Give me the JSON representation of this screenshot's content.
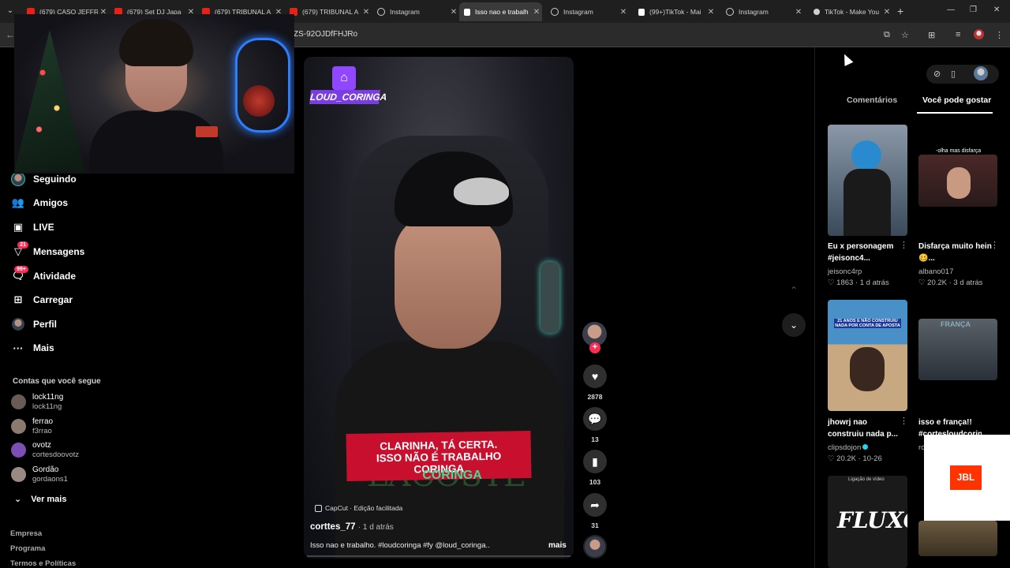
{
  "browser": {
    "tabs": [
      {
        "title": "(679) CASO JEFFR",
        "icon": "youtube-icon"
      },
      {
        "title": "(679) Set DJ Japa",
        "icon": "youtube-icon"
      },
      {
        "title": "(679) TRIBUNAL A",
        "icon": "youtube-icon"
      },
      {
        "title": "(679) TRIBUNAL A",
        "icon": "youtube-icon"
      },
      {
        "title": "Instagram",
        "icon": "instagram-icon"
      },
      {
        "title": "Isso nao e trabalh",
        "icon": "tiktok-icon",
        "active": true
      },
      {
        "title": "Instagram",
        "icon": "instagram-icon"
      },
      {
        "title": "(99+)TikTok - Mai",
        "icon": "tiktok-icon"
      },
      {
        "title": "Instagram",
        "icon": "instagram-icon"
      },
      {
        "title": "TikTok - Make You",
        "icon": "tiktok-icon"
      }
    ],
    "url_fragment": "ZS-92OJDfFHJRo"
  },
  "sidebar": {
    "items": [
      {
        "label": "Seguindo",
        "icon": "following-avatar-icon"
      },
      {
        "label": "Amigos",
        "icon": "friends-icon"
      },
      {
        "label": "LIVE",
        "icon": "live-icon"
      },
      {
        "label": "Mensagens",
        "icon": "messages-icon",
        "badge": "21"
      },
      {
        "label": "Atividade",
        "icon": "activity-icon",
        "badge": "99+"
      },
      {
        "label": "Carregar",
        "icon": "upload-icon"
      },
      {
        "label": "Perfil",
        "icon": "profile-icon"
      },
      {
        "label": "Mais",
        "icon": "more-icon"
      }
    ],
    "following_header": "Contas que você segue",
    "accounts": [
      {
        "name": "lock11ng",
        "username": "lock11ng",
        "color": "#6a5a55"
      },
      {
        "name": "ferrao",
        "username": "f3rrao",
        "color": "#8a7a70"
      },
      {
        "name": "ovotz",
        "username": "cortesdoovotz",
        "color": "#7b4fb3"
      },
      {
        "name": "Gordão",
        "username": "gordaons1",
        "color": "#9a8a84"
      }
    ],
    "see_more": "Ver mais",
    "footer": [
      "Empresa",
      "Programa",
      "Termos e Políticas"
    ]
  },
  "video": {
    "channel_badge": "LOUD_CORINGA",
    "caption_lines": [
      "CLARINHA, TÁ CERTA.",
      "ISSO NÃO É TRABALHO",
      "CORINGA"
    ],
    "caption_accent": "CORINGA",
    "shirt_text": "LACOSTE",
    "capcut_label": "CapCut · Edição facilitada",
    "author": "corttes_77",
    "time_ago": "· 1 d atrás",
    "description": "Isso nao e trabalho. #loudcoringa #fy @loud_coringa..",
    "more_label": "mais"
  },
  "actions": {
    "likes": "2878",
    "comments": "13",
    "saves": "103",
    "shares": "31"
  },
  "right_panel": {
    "tab_comments": "Comentários",
    "tab_recommended": "Você pode gostar",
    "videos": [
      {
        "title": "Eu x personagem #jeisonc4...",
        "author": "jeisonc4rp",
        "stats": "♡ 1863 · 1 d atrás",
        "color": "#4a6a8a"
      },
      {
        "title": "Disfarça muito hein 🥴...",
        "author": "albano017",
        "stats": "♡ 20.2K · 3 d atrás",
        "color": "#5a3030",
        "overlay": "-olha mas disfarça"
      },
      {
        "title": "jhowrj nao construiu nada p...",
        "author": "clipsdojon",
        "stats": "♡ 20.2K · 10-26",
        "color": "#5a8ab0",
        "verified": true,
        "overlay": "21 ANOS E NÃO CONSTRUIU NADA POR CONTA DE APOSTA"
      },
      {
        "title": "isso e frança!! #cortesloudcorin...",
        "author": "ro",
        "stats": "",
        "color": "#3a4048",
        "overlay": "FRANÇA"
      },
      {
        "title": "",
        "author": "",
        "stats": "",
        "color": "#2a2a2a",
        "overlay": "FLUXO",
        "top_label": "Ligação de vídeo"
      },
      {
        "title": "",
        "author": "",
        "stats": "",
        "color": "#5a4a30"
      }
    ],
    "ad_brand": "JBL"
  }
}
